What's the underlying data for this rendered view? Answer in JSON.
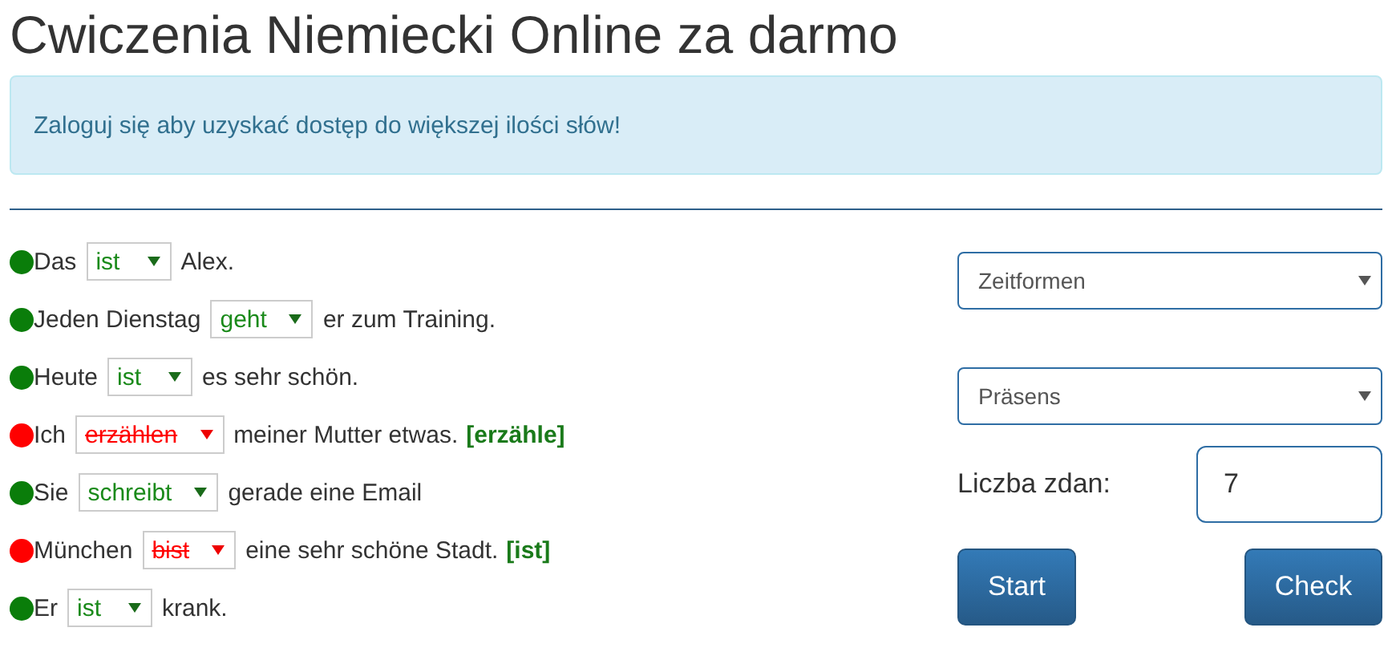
{
  "title": "Cwiczenia Niemiecki Online za darmo",
  "alert": "Zaloguj się aby uzyskać dostęp do większej ilości słów!",
  "sentences": [
    {
      "before": "Das",
      "answer": "ist",
      "after": "Alex.",
      "correct": true
    },
    {
      "before": "Jeden Dienstag",
      "answer": "geht",
      "after": "er zum Training.",
      "correct": true
    },
    {
      "before": "Heute",
      "answer": "ist",
      "after": "es sehr schön.",
      "correct": true
    },
    {
      "before": "Ich",
      "answer": "erzählen",
      "after": "meiner Mutter etwas.",
      "correct": false,
      "correction": "[erzähle]"
    },
    {
      "before": "Sie",
      "answer": "schreibt",
      "after": "gerade eine Email",
      "correct": true
    },
    {
      "before": "München",
      "answer": "bist",
      "after": "eine sehr schöne Stadt.",
      "correct": false,
      "correction": "[ist]"
    },
    {
      "before": "Er",
      "answer": "ist",
      "after": "krank.",
      "correct": true
    }
  ],
  "category_select": "Zeitformen",
  "tense_select": "Präsens",
  "count_label": "Liczba zdan:",
  "count_value": "7",
  "buttons": [
    "Start",
    "Check"
  ]
}
